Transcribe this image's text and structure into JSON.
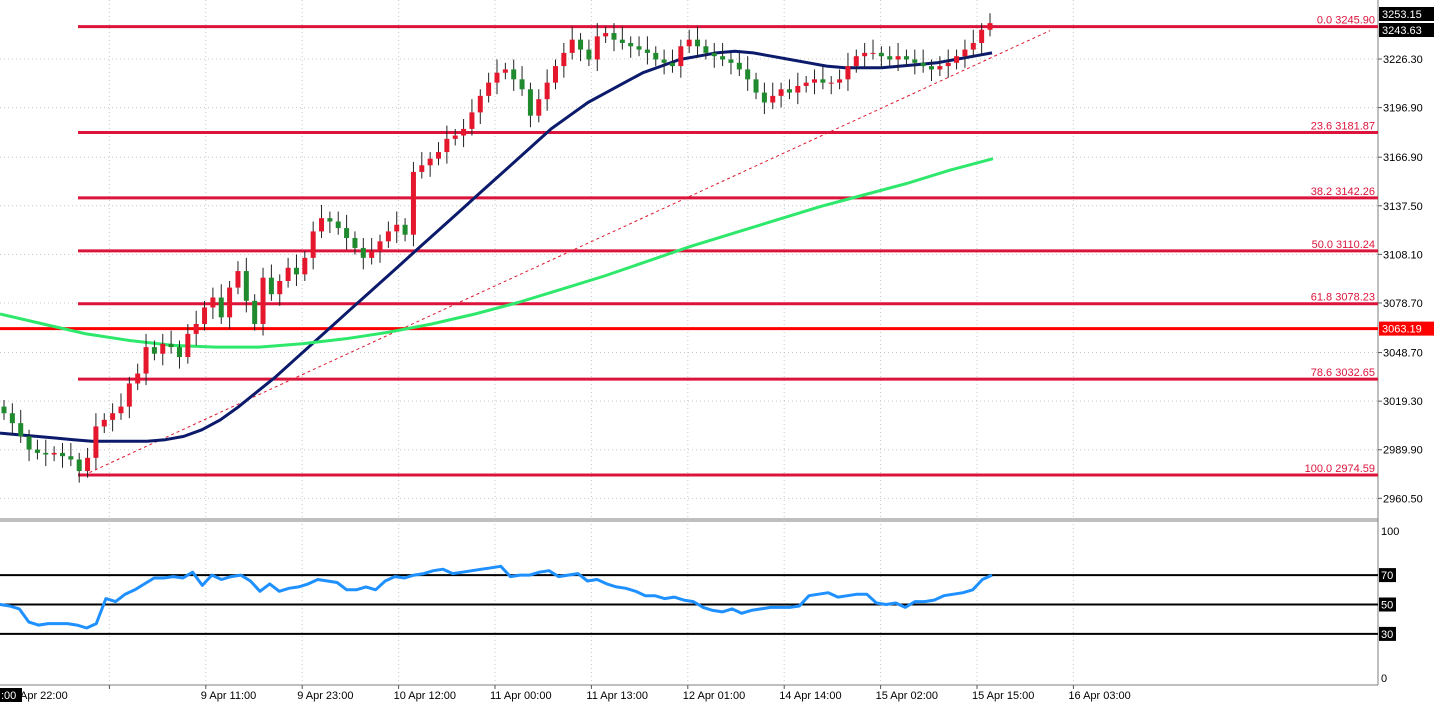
{
  "chart_data": {
    "type": "candlestick",
    "instrument_note": "",
    "price_axis": {
      "range": [
        2948,
        3262
      ],
      "ticks": [
        "3226.30",
        "3196.90",
        "3166.90",
        "3137.50",
        "3108.10",
        "3078.70",
        "3048.70",
        "3019.30",
        "2989.90",
        "2960.50"
      ],
      "tick_values": [
        3226.3,
        3196.9,
        3166.9,
        3137.5,
        3108.1,
        3078.7,
        3048.7,
        3019.3,
        2989.9,
        2960.5
      ],
      "price_labels": [
        {
          "text": "3253.15",
          "value": 3253.15,
          "style": "dark"
        },
        {
          "text": "3243.63",
          "value": 3243.63,
          "style": "dark"
        },
        {
          "text": "3063.19",
          "value": 3063.19,
          "style": "red"
        }
      ]
    },
    "time_axis": {
      "labels": [
        ":00",
        "Apr 22:00",
        "9 Apr 11:00",
        "9 Apr 23:00",
        "10 Apr 12:00",
        "11 Apr 00:00",
        "11 Apr 13:00",
        "12 Apr 01:00",
        "14 Apr 14:00",
        "15 Apr 02:00",
        "15 Apr 15:00",
        "16 Apr 03:00"
      ]
    },
    "fibonacci_levels": [
      {
        "label": "0.0 3245.90",
        "value": 3245.9
      },
      {
        "label": "23.6 3181.87",
        "value": 3181.87
      },
      {
        "label": "38.2 3142.26",
        "value": 3142.26
      },
      {
        "label": "50.0 3110.24",
        "value": 3110.24
      },
      {
        "label": "61.8 3078.23",
        "value": 3078.23
      },
      {
        "label": "78.6 3032.65",
        "value": 3032.65
      },
      {
        "label": "100.0 2974.59",
        "value": 2974.59
      }
    ],
    "horizontal_line": {
      "value": 3063.19,
      "color": "#ff0000"
    },
    "close_series": [
      3012,
      3006,
      2998,
      2990,
      2988,
      2987,
      2988,
      2986,
      2984,
      2977,
      2985,
      3004,
      3008,
      3012,
      3016,
      3030,
      3036,
      3052,
      3048,
      3054,
      3052,
      3046,
      3060,
      3066,
      3076,
      3082,
      3070,
      3088,
      3098,
      3080,
      3066,
      3094,
      3084,
      3092,
      3100,
      3096,
      3106,
      3122,
      3130,
      3128,
      3124,
      3118,
      3112,
      3106,
      3110,
      3116,
      3122,
      3126,
      3120,
      3158,
      3162,
      3166,
      3170,
      3178,
      3180,
      3184,
      3194,
      3204,
      3212,
      3218,
      3220,
      3214,
      3208,
      3192,
      3202,
      3212,
      3222,
      3230,
      3238,
      3232,
      3226,
      3240,
      3242,
      3238,
      3236,
      3234,
      3232,
      3230,
      3226,
      3224,
      3222,
      3234,
      3238,
      3234,
      3230,
      3228,
      3226,
      3224,
      3220,
      3214,
      3206,
      3200,
      3204,
      3208,
      3206,
      3210,
      3212,
      3214,
      3212,
      3212,
      3214,
      3222,
      3228,
      3230,
      3230,
      3228,
      3226,
      3228,
      3226,
      3224,
      3222,
      3220,
      3222,
      3224,
      3228,
      3232,
      3236,
      3244,
      3248
    ],
    "moving_averages": [
      {
        "color": "#0b1a6b",
        "values": [
          3000,
          2999,
          2998,
          2997,
          2996,
          2995,
          2995,
          2995,
          2995,
          2996,
          2998,
          3002,
          3008,
          3016,
          3025,
          3034,
          3044,
          3054,
          3064,
          3074,
          3084,
          3094,
          3104,
          3114,
          3124,
          3134,
          3144,
          3154,
          3164,
          3174,
          3184,
          3192,
          3200,
          3206,
          3212,
          3218,
          3222,
          3226,
          3228,
          3230,
          3231,
          3230,
          3228,
          3226,
          3224,
          3222,
          3221,
          3221,
          3221,
          3222,
          3223,
          3224,
          3226,
          3228,
          3230
        ]
      },
      {
        "color": "#2ee86b",
        "values": [
          3072,
          3066,
          3060,
          3056,
          3053,
          3052,
          3052,
          3054,
          3057,
          3061,
          3066,
          3072,
          3079,
          3087,
          3095,
          3104,
          3113,
          3121,
          3129,
          3137,
          3144,
          3151,
          3159,
          3166
        ]
      }
    ],
    "trendline": {
      "from": 2974.59,
      "to": 3245.9,
      "style": "dotted",
      "color": "#e0192f"
    },
    "rsi": {
      "axis_labels": [
        "100",
        "70",
        "50",
        "30",
        "0"
      ],
      "levels": [
        70,
        50,
        30
      ],
      "range": [
        0,
        100
      ],
      "values": [
        50,
        49,
        47,
        38,
        36,
        37,
        37,
        37,
        36,
        34,
        37,
        54,
        52,
        57,
        60,
        64,
        68,
        68,
        69,
        68,
        72,
        63,
        70,
        67,
        69,
        70,
        66,
        59,
        64,
        59,
        61,
        62,
        64,
        67,
        66,
        65,
        60,
        60,
        62,
        60,
        66,
        69,
        68,
        70,
        71,
        73,
        74,
        71,
        72,
        73,
        74,
        75,
        76,
        69,
        70,
        70,
        72,
        73,
        69,
        70,
        71,
        66,
        67,
        64,
        62,
        61,
        59,
        56,
        56,
        54,
        55,
        53,
        52,
        48,
        46,
        45,
        47,
        44,
        46,
        47,
        48,
        48,
        48,
        49,
        56,
        57,
        58,
        55,
        56,
        57,
        57,
        51,
        50,
        51,
        48,
        52,
        52,
        53,
        56,
        57,
        58,
        60,
        67,
        70
      ]
    }
  }
}
